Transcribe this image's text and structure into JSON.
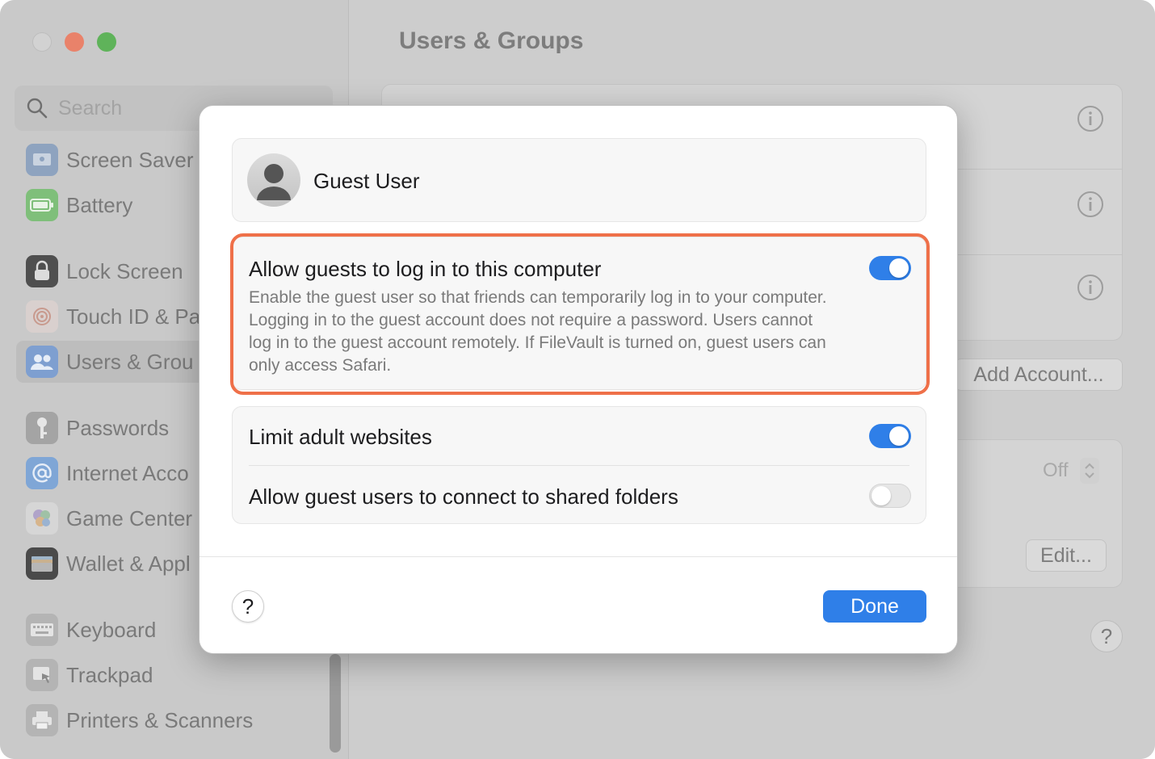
{
  "window": {
    "title": "Users & Groups",
    "search_placeholder": "Search"
  },
  "sidebar": {
    "items": [
      {
        "label": "Screen Saver",
        "icon": "screen-saver-icon"
      },
      {
        "label": "Battery",
        "icon": "battery-icon"
      },
      {
        "label": "Lock Screen",
        "icon": "lock-screen-icon"
      },
      {
        "label": "Touch ID & Pa",
        "icon": "fingerprint-icon"
      },
      {
        "label": "Users & Grou",
        "icon": "users-icon"
      },
      {
        "label": "Passwords",
        "icon": "key-icon"
      },
      {
        "label": "Internet Acco",
        "icon": "at-sign-icon"
      },
      {
        "label": "Game Center",
        "icon": "game-center-icon"
      },
      {
        "label": "Wallet & Appl",
        "icon": "wallet-icon"
      },
      {
        "label": "Keyboard",
        "icon": "keyboard-icon"
      },
      {
        "label": "Trackpad",
        "icon": "trackpad-icon"
      },
      {
        "label": "Printers & Scanners",
        "icon": "printer-icon"
      }
    ]
  },
  "main": {
    "add_account_label": "Add Account...",
    "off_label": "Off",
    "edit_label": "Edit...",
    "help_label": "?"
  },
  "sheet": {
    "guest_name": "Guest User",
    "allow_guests": {
      "title": "Allow guests to log in to this computer",
      "description": "Enable the guest user so that friends can temporarily log in to your computer. Logging in to the guest account does not require a password. Users cannot log in to the guest account remotely. If FileVault is turned on, guest users can only access Safari.",
      "enabled": true
    },
    "limit_adult": {
      "label": "Limit adult websites",
      "enabled": true
    },
    "shared_folders": {
      "label": "Allow guest users to connect to shared folders",
      "enabled": false
    },
    "help_label": "?",
    "done_label": "Done"
  },
  "colors": {
    "accent": "#2f7fe8",
    "highlight": "#ef7049"
  }
}
